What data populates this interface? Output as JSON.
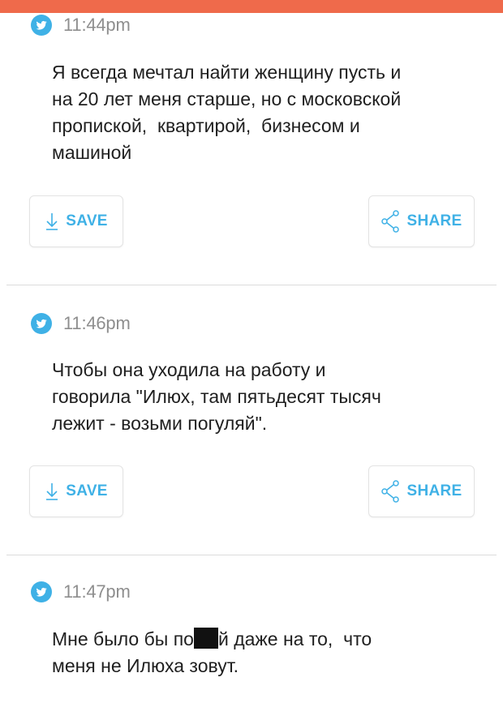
{
  "colors": {
    "top_bar": "#ef6a4b",
    "accent": "#3fb1e6",
    "time_text": "#8e8e8e"
  },
  "posts": [
    {
      "time": "11:44pm",
      "text": "Я всегда мечтал найти женщину пусть и\nна 20 лет меня старше, но с московской\nпропиской,  квартирой,  бизнесом и\nмашиной",
      "save_label": "SAVE",
      "share_label": "SHARE"
    },
    {
      "time": "11:46pm",
      "text": "Чтобы она уходила на работу и\nговорила \"Илюх, там пятьдесят тысяч\nлежит - возьми погуляй\".",
      "save_label": "SAVE",
      "share_label": "SHARE"
    },
    {
      "time": "11:47pm",
      "text_before": "Мне было бы по",
      "text_after": "й даже на то,  что\nменя не Илюха зовут."
    }
  ],
  "icons": {
    "post_icon": "twitter-bird-icon",
    "save_icon": "download-arrow-icon",
    "share_icon": "share-icon"
  }
}
